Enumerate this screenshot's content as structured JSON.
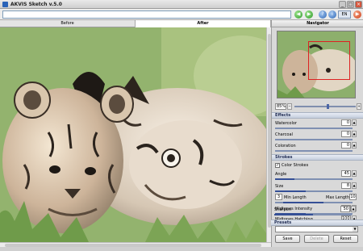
{
  "window": {
    "title": "AKVIS Sketch v.5.0",
    "minimize": "_",
    "maximize": "□",
    "close": "×"
  },
  "toolbar": {
    "path_value": "",
    "back_icon": "◀",
    "forward_icon": "▶",
    "help_icon": "?",
    "info_icon": "i",
    "language": "EN",
    "run_icon": "▶"
  },
  "tabs": [
    {
      "label": "Before"
    },
    {
      "label": "After"
    }
  ],
  "navigator": {
    "title": "Navigator",
    "zoom": "85%",
    "zoom_level": 0.55
  },
  "effects": {
    "title": "Effects",
    "params": [
      {
        "label": "Watercolor",
        "value": "0",
        "level": 0
      },
      {
        "label": "Charcoal",
        "value": "0",
        "level": 0
      },
      {
        "label": "Coloration",
        "value": "0",
        "level": 0
      }
    ]
  },
  "strokes": {
    "title": "Strokes",
    "color_strokes_label": "Color Strokes",
    "color_strokes_checked": true,
    "angle": {
      "label": "Angle",
      "value": "45",
      "level": 0.25
    },
    "size": {
      "label": "Size",
      "value": "8",
      "level": 0.4
    },
    "length": {
      "min_value": "3",
      "min_label": "Min Length",
      "max_label": "Max Length",
      "max_value": "10"
    },
    "midtones_intensity": {
      "label": "Midtones Intensity",
      "value": "5",
      "level": 0.4
    },
    "midtones_hatching": {
      "label": "Midtones Hatching",
      "value": "100",
      "level": 1.0
    },
    "sharpen": {
      "label": "Sharpen",
      "value": "50",
      "level": 0.5
    }
  },
  "presets": {
    "title": "Presets",
    "selected": "",
    "save": "Save",
    "delete": "Delete",
    "reset": "Reset"
  }
}
